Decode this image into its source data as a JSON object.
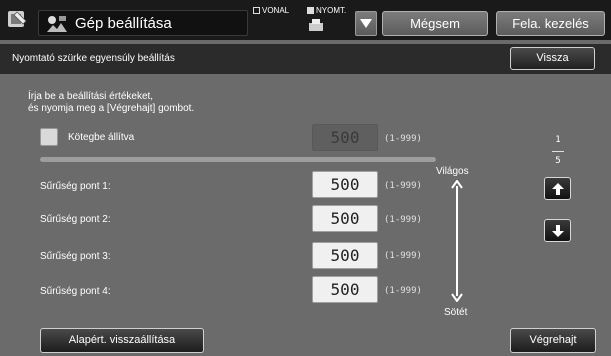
{
  "header": {
    "title": "Gép beállítása",
    "mode_line": "VONAL",
    "mode_print": "NYOMT.",
    "cancel_label": "Mégsem",
    "job_label": "Fela. kezelés",
    "app_icon": "settings-wrench-icon",
    "title_icon": "machine-settings-icon",
    "mode_icon": "printer-status-icon",
    "dropdown_icon": "chevron-down-icon"
  },
  "subheader": {
    "title": "Nyomtató szürke egyensúly beállítás",
    "back_label": "Vissza"
  },
  "content": {
    "instruction_line1": "Írja be a beállítási értékeket,",
    "instruction_line2": "és nyomja meg a [Végrehajt] gombot.",
    "batch": {
      "label": "Kötegbe állítva",
      "value": "500",
      "range": "(1-999)",
      "checked": false
    },
    "points": [
      {
        "label": "Sűrűség pont 1:",
        "value": "500",
        "range": "(1-999)"
      },
      {
        "label": "Sűrűség pont 2:",
        "value": "500",
        "range": "(1-999)"
      },
      {
        "label": "Sűrűség pont 3:",
        "value": "500",
        "range": "(1-999)"
      },
      {
        "label": "Sűrűség pont 4:",
        "value": "500",
        "range": "(1-999)"
      }
    ],
    "scale_light": "Világos",
    "scale_dark": "Sötét"
  },
  "pager": {
    "current": "1",
    "total": "5",
    "up_icon": "arrow-up-icon",
    "down_icon": "arrow-down-icon"
  },
  "footer": {
    "reset_label": "Alapért. visszaállítása",
    "execute_label": "Végrehajt"
  },
  "colors": {
    "panel_bg": "#6b6b6b",
    "topbar_bg": "#1a1a1a",
    "subheader_bg": "#2b2b2b",
    "value_box_bg": "#f0f0f0"
  }
}
